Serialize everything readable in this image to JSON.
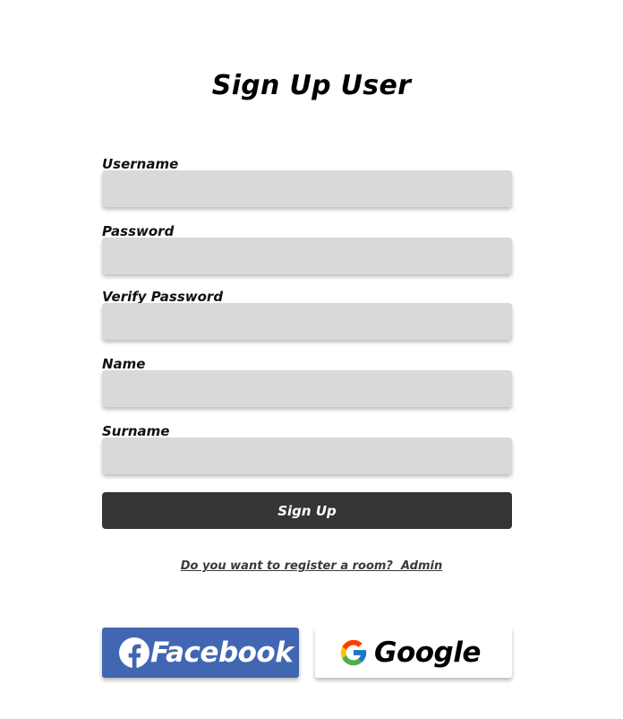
{
  "title": "Sign Up User",
  "fields": [
    {
      "label": "Username",
      "value": "",
      "placeholder": ""
    },
    {
      "label": "Password",
      "value": "",
      "placeholder": ""
    },
    {
      "label": "Verify Password",
      "value": "",
      "placeholder": ""
    },
    {
      "label": "Name",
      "value": "",
      "placeholder": ""
    },
    {
      "label": "Surname",
      "value": "",
      "placeholder": ""
    }
  ],
  "signup_button": "Sign Up",
  "register_link": "Do you want to register a room?  Admin",
  "social": {
    "facebook": {
      "label": "Facebook",
      "icon": "facebook-icon",
      "color": "#4267b2"
    },
    "google": {
      "label": "Google",
      "icon": "google-icon",
      "color": "#ffffff"
    }
  },
  "colors": {
    "input_bg": "#d9d9d9",
    "button_bg": "#353535"
  }
}
